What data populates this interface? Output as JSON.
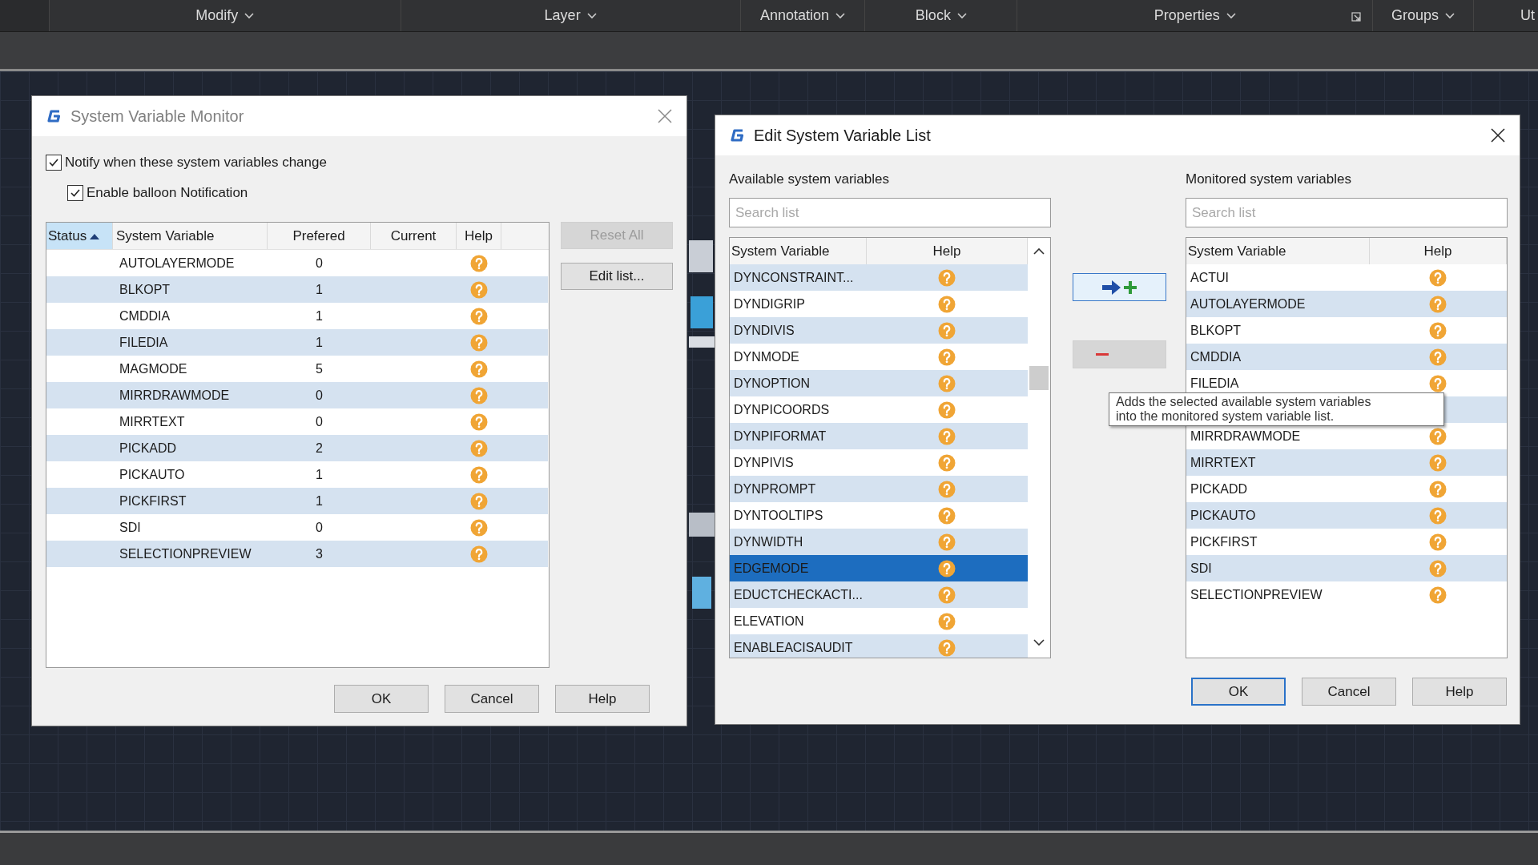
{
  "ribbon": {
    "panels": [
      {
        "label": "Modify",
        "dropdown": true,
        "launcher": false
      },
      {
        "label": "Layer",
        "dropdown": true,
        "launcher": false
      },
      {
        "label": "Annotation",
        "dropdown": true,
        "launcher": false
      },
      {
        "label": "Block",
        "dropdown": true,
        "launcher": false
      },
      {
        "label": "Properties",
        "dropdown": true,
        "launcher": true
      },
      {
        "label": "Groups",
        "dropdown": true,
        "launcher": false
      },
      {
        "label": "Ut",
        "dropdown": false,
        "launcher": false
      }
    ]
  },
  "monitor_dialog": {
    "title": "System Variable Monitor",
    "active": false,
    "checkboxes": [
      {
        "label": "Notify when these system variables change",
        "checked": true,
        "kind": "main"
      },
      {
        "label": "Enable balloon Notification",
        "checked": true,
        "kind": "sub"
      }
    ],
    "table": {
      "columns": [
        {
          "label": "Status",
          "sorted": true
        },
        {
          "label": "System Variable",
          "sorted": false
        },
        {
          "label": "Prefered",
          "sorted": false
        },
        {
          "label": "Current",
          "sorted": false
        },
        {
          "label": "Help",
          "sorted": false
        }
      ],
      "rows": [
        {
          "name": "AUTOLAYERMODE",
          "preferred": "0"
        },
        {
          "name": "BLKOPT",
          "preferred": "1"
        },
        {
          "name": "CMDDIA",
          "preferred": "1"
        },
        {
          "name": "FILEDIA",
          "preferred": "1"
        },
        {
          "name": "MAGMODE",
          "preferred": "5"
        },
        {
          "name": "MIRRDRAWMODE",
          "preferred": "0"
        },
        {
          "name": "MIRRTEXT",
          "preferred": "0"
        },
        {
          "name": "PICKADD",
          "preferred": "2"
        },
        {
          "name": "PICKAUTO",
          "preferred": "1"
        },
        {
          "name": "PICKFIRST",
          "preferred": "1"
        },
        {
          "name": "SDI",
          "preferred": "0"
        },
        {
          "name": "SELECTIONPREVIEW",
          "preferred": "3"
        }
      ]
    },
    "side_buttons": [
      {
        "label": "Reset All",
        "disabled": true
      },
      {
        "label": "Edit list...",
        "disabled": false
      }
    ],
    "footer_buttons": [
      {
        "label": "OK",
        "default": false
      },
      {
        "label": "Cancel",
        "default": false
      },
      {
        "label": "Help",
        "default": false
      }
    ]
  },
  "edit_dialog": {
    "title": "Edit System Variable List",
    "active": true,
    "available": {
      "label": "Available system variables",
      "search": {
        "placeholder": "Search list"
      },
      "columns": [
        "System Variable",
        "Help"
      ],
      "rows": [
        {
          "name": "DYNCONSTRAINT...",
          "selected": false
        },
        {
          "name": "DYNDIGRIP",
          "selected": false
        },
        {
          "name": "DYNDIVIS",
          "selected": false
        },
        {
          "name": "DYNMODE",
          "selected": false
        },
        {
          "name": "DYNOPTION",
          "selected": false
        },
        {
          "name": "DYNPICOORDS",
          "selected": false
        },
        {
          "name": "DYNPIFORMAT",
          "selected": false
        },
        {
          "name": "DYNPIVIS",
          "selected": false
        },
        {
          "name": "DYNPROMPT",
          "selected": false
        },
        {
          "name": "DYNTOOLTIPS",
          "selected": false
        },
        {
          "name": "DYNWIDTH",
          "selected": false
        },
        {
          "name": "EDGEMODE",
          "selected": true
        },
        {
          "name": "EDUCTCHECKACTI...",
          "selected": false
        },
        {
          "name": "ELEVATION",
          "selected": false
        },
        {
          "name": "ENABLEACISAUDIT",
          "selected": false
        }
      ]
    },
    "monitored": {
      "label": "Monitored system variables",
      "search": {
        "placeholder": "Search list"
      },
      "columns": [
        "System Variable",
        "Help"
      ],
      "rows": [
        {
          "name": "ACTUI",
          "covered": false
        },
        {
          "name": "AUTOLAYERMODE",
          "covered": false
        },
        {
          "name": "BLKOPT",
          "covered": false
        },
        {
          "name": "CMDDIA",
          "covered": false
        },
        {
          "name": "FILEDIA",
          "covered": false
        },
        {
          "covered": true
        },
        {
          "name": "MIRRDRAWMODE",
          "covered": false
        },
        {
          "name": "MIRRTEXT",
          "covered": false
        },
        {
          "name": "PICKADD",
          "covered": false
        },
        {
          "name": "PICKAUTO",
          "covered": false
        },
        {
          "name": "PICKFIRST",
          "covered": false
        },
        {
          "name": "SDI",
          "covered": false
        },
        {
          "name": "SELECTIONPREVIEW",
          "covered": false
        }
      ]
    },
    "tooltip": {
      "lines": [
        "Adds the selected available system variables",
        "into the monitored system variable list."
      ]
    },
    "footer_buttons": [
      {
        "label": "OK",
        "default": true
      },
      {
        "label": "Cancel",
        "default": false
      },
      {
        "label": "Help",
        "default": false
      }
    ]
  }
}
